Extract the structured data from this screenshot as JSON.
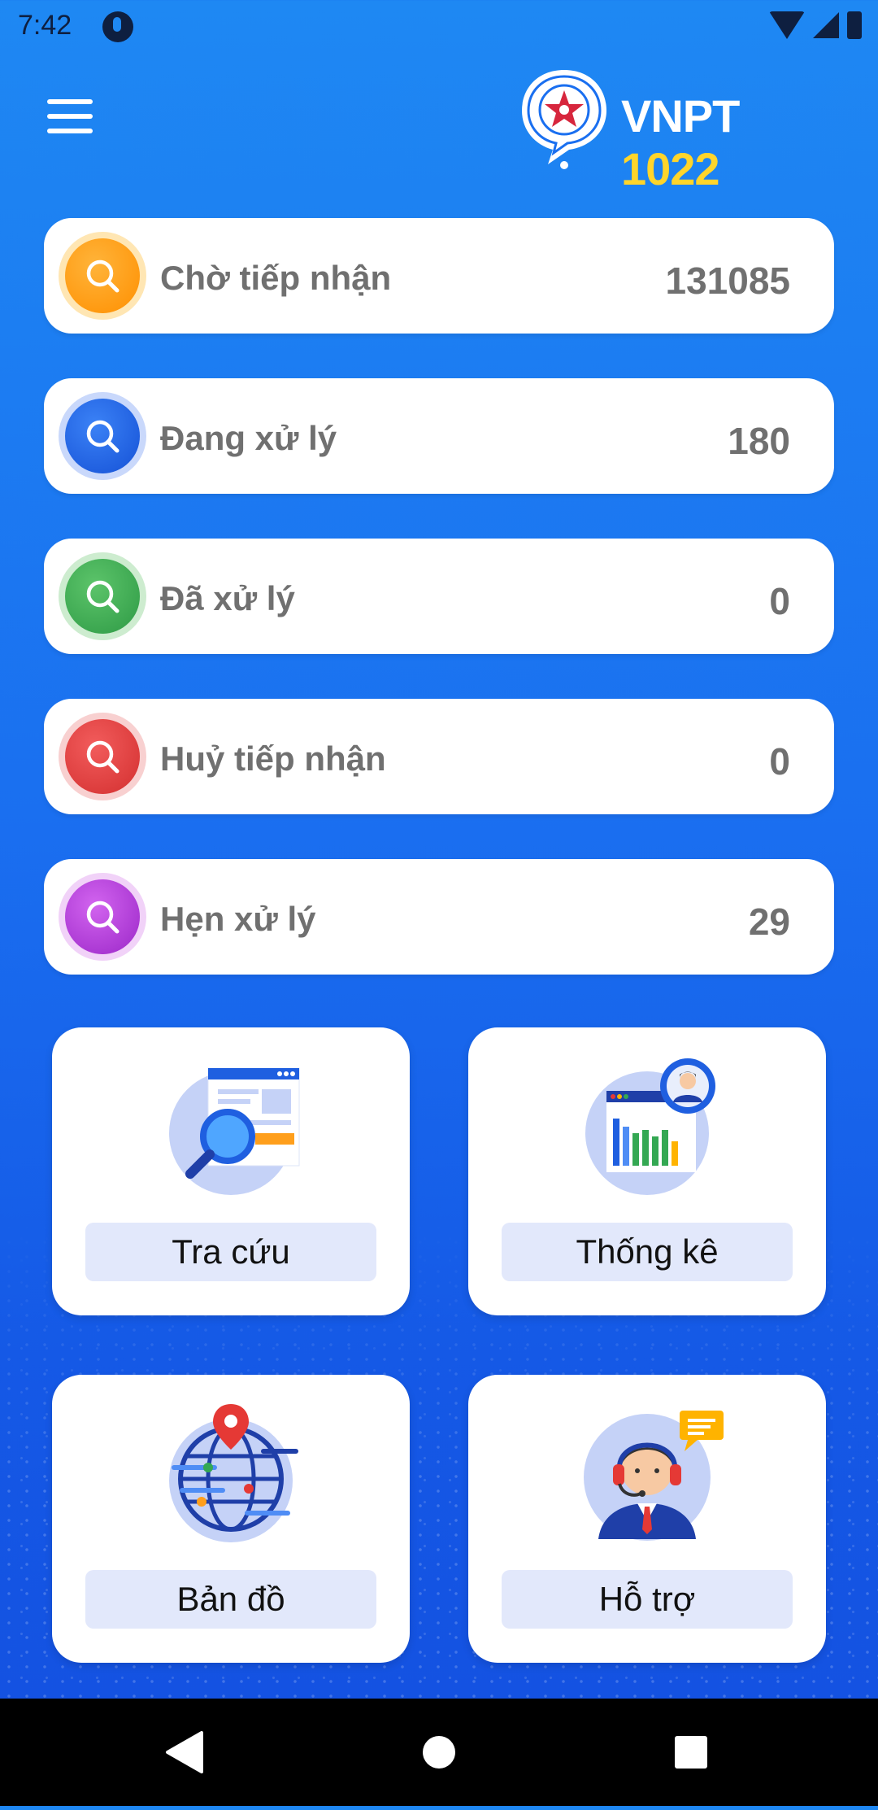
{
  "status_bar": {
    "time": "7:42"
  },
  "header": {
    "logo_brand": "VNPT",
    "logo_number": "1022"
  },
  "status_cards": [
    {
      "label": "Chờ tiếp nhận",
      "count": "131085",
      "color": "#ff9800"
    },
    {
      "label": "Đang xử lý",
      "count": "180",
      "color": "#1a5fe0"
    },
    {
      "label": "Đã xử lý",
      "count": "0",
      "color": "#34a853"
    },
    {
      "label": "Huỷ tiếp nhận",
      "count": "0",
      "color": "#e53935"
    },
    {
      "label": "Hẹn xử lý",
      "count": "29",
      "color": "#b02fd8"
    }
  ],
  "tiles": [
    {
      "label": "Tra cứu",
      "icon": "document-search-icon"
    },
    {
      "label": "Thống kê",
      "icon": "statistics-chart-icon"
    },
    {
      "label": "Bản đồ",
      "icon": "globe-map-icon"
    },
    {
      "label": "Hỗ trợ",
      "icon": "support-agent-icon"
    }
  ],
  "colors": {
    "background_top": "#1e88f3",
    "background_bottom": "#1450e0",
    "logo_accent": "#ffd52b",
    "tile_label_bg": "#e2e8fb"
  }
}
